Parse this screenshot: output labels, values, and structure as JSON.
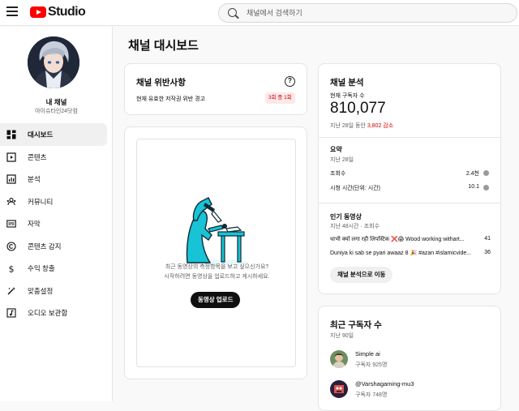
{
  "header": {
    "logo_text": "Studio",
    "search_placeholder": "채널에서 검색하기"
  },
  "sidebar": {
    "channel_name": "내 채널",
    "channel_handle": "아이슈타인24닷컴",
    "items": [
      {
        "label": "대시보드",
        "icon": "dashboard-icon",
        "active": true
      },
      {
        "label": "콘텐츠",
        "icon": "content-icon"
      },
      {
        "label": "분석",
        "icon": "analytics-icon"
      },
      {
        "label": "커뮤니티",
        "icon": "community-icon"
      },
      {
        "label": "자막",
        "icon": "subtitles-icon"
      },
      {
        "label": "콘텐츠 감지",
        "icon": "copyright-icon"
      },
      {
        "label": "수익 창출",
        "icon": "dollar-icon"
      },
      {
        "label": "맞춤설정",
        "icon": "magic-wand-icon"
      },
      {
        "label": "오디오 보관함",
        "icon": "audio-library-icon"
      }
    ]
  },
  "main": {
    "page_title": "채널 대시보드",
    "violations": {
      "title": "채널 위반사항",
      "text": "현재 유효한 저작권 위반 경고",
      "badge": "3회 중 1회"
    },
    "upload": {
      "line1": "최근 동영상의 측정항목을 보고 싶으신가요?",
      "line2": "시작하려면 동영상을 업로드하고 게시하세요.",
      "button": "동영상 업로드"
    },
    "analytics": {
      "title": "채널 분석",
      "subs_label": "현재 구독자 수",
      "subs_value": "810,077",
      "change_prefix": "지난 28일 동안",
      "change_value": "3,802 감소",
      "summary_title": "요약",
      "summary_period": "지난 28일",
      "rows": [
        {
          "label": "조회수",
          "value": "2.4천"
        },
        {
          "label": "시청 시간(단위: 시간)",
          "value": "10.1"
        }
      ],
      "top_title": "인기 동영상",
      "top_period": "지난 48시간 · 조회수",
      "videos": [
        {
          "title": "धाभी क्यों लगा रही लिपस्टिक ❌😱 Wood working withart...",
          "views": "41"
        },
        {
          "title": "Duniya ki sab se pyari awaaz 8 🎉 #azan #islamicvide...",
          "views": "36"
        }
      ],
      "button": "채널 분석으로 이동"
    },
    "recent_subs": {
      "title": "최근 구독자 수",
      "period": "지난 90일",
      "items": [
        {
          "name": "Simple ai",
          "subs": "구독자 925명"
        },
        {
          "name": "@Varshagaming-mu3",
          "subs": "구독자 748명"
        }
      ]
    }
  },
  "colors": {
    "brand_red": "#ff0000",
    "warning_red": "#cc0000",
    "illustration_cyan": "#19c3d6"
  }
}
